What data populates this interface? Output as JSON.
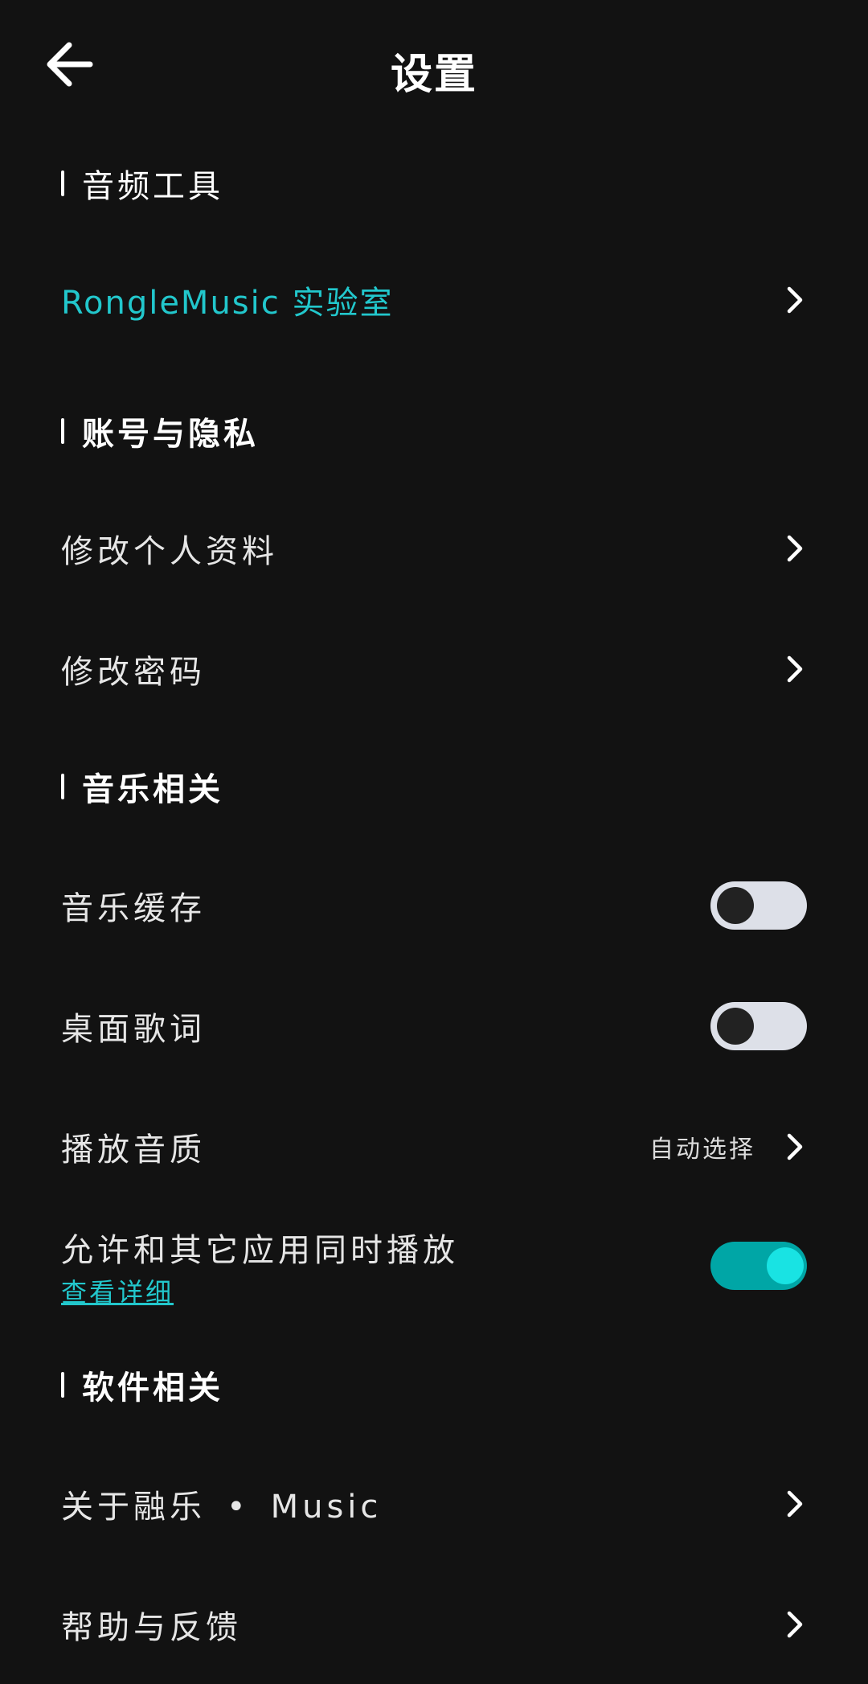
{
  "header": {
    "title": "设置",
    "back_icon": "arrow-left-icon"
  },
  "sections": {
    "audio_tools": {
      "title": "音频工具",
      "items": [
        {
          "label": "RongleMusic  实验室",
          "icon": "chevron-right-icon"
        }
      ]
    },
    "account_privacy": {
      "title": "账号与隐私",
      "items": [
        {
          "label": "修改个人资料",
          "icon": "chevron-right-icon"
        },
        {
          "label": "修改密码",
          "icon": "chevron-right-icon"
        }
      ]
    },
    "music": {
      "title": "音乐相关",
      "items": [
        {
          "label": "音乐缓存",
          "toggle": "off"
        },
        {
          "label": "桌面歌词",
          "toggle": "off"
        },
        {
          "label": "播放音质",
          "value": "自动选择",
          "icon": "chevron-right-icon"
        },
        {
          "label": "允许和其它应用同时播放",
          "link": "查看详细",
          "toggle": "on"
        }
      ]
    },
    "software": {
      "title": "软件相关",
      "items": [
        {
          "label_part1": "关于融乐",
          "separator": "•",
          "label_part2": "Music",
          "icon": "chevron-right-icon"
        },
        {
          "label": "帮助与反馈",
          "icon": "chevron-right-icon"
        }
      ]
    }
  },
  "colors": {
    "background": "#121212",
    "accent": "#22c7cc",
    "toggle_on": "#00a6a6",
    "toggle_off": "#dde0e8"
  }
}
